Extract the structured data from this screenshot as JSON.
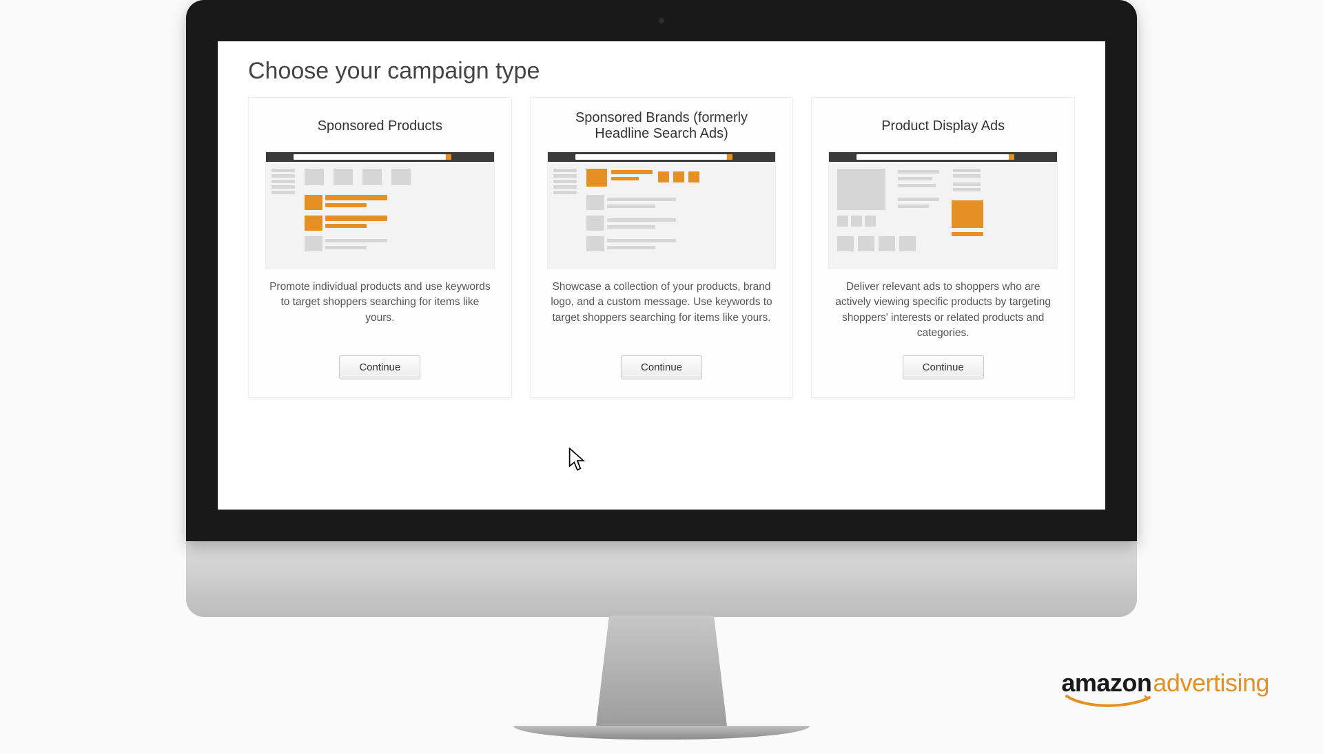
{
  "page": {
    "title": "Choose your campaign type"
  },
  "cards": [
    {
      "title": "Sponsored Products",
      "description": "Promote individual products and use keywords to target shoppers searching for items like yours.",
      "button": "Continue"
    },
    {
      "title": "Sponsored Brands (formerly Headline Search Ads)",
      "description": "Showcase a collection of your products, brand logo, and a custom message. Use keywords to target shoppers searching for items like yours.",
      "button": "Continue"
    },
    {
      "title": "Product Display Ads",
      "description": "Deliver relevant ads to shoppers who are actively viewing specific products by targeting shoppers' interests or related products and categories.",
      "button": "Continue"
    }
  ],
  "brand": {
    "part1": "amazon",
    "part2": "advertising"
  }
}
